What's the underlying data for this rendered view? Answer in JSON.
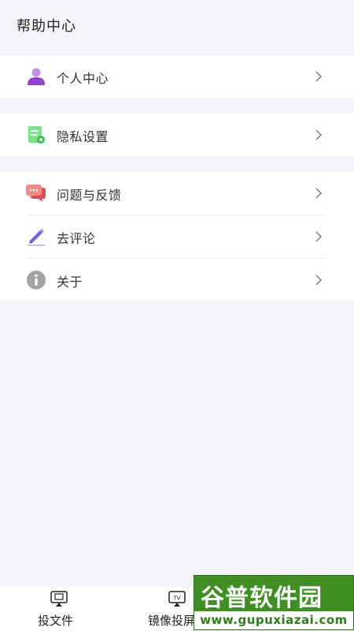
{
  "header": {
    "title": "帮助中心"
  },
  "group1": [
    {
      "label": "个人中心",
      "icon": "person-icon"
    }
  ],
  "group2": [
    {
      "label": "隐私设置",
      "icon": "privacy-settings-icon"
    }
  ],
  "group3": [
    {
      "label": "问题与反馈",
      "icon": "feedback-chat-icon"
    },
    {
      "label": "去评论",
      "icon": "pen-icon"
    },
    {
      "label": "关于",
      "icon": "info-icon"
    }
  ],
  "tabbar": {
    "tabs": [
      {
        "label": "投文件",
        "icon": "file-cast-icon"
      },
      {
        "label": "镜像投屏",
        "icon": "tv-cast-icon"
      }
    ]
  },
  "watermark": {
    "line1": "谷普软件园",
    "line2": "www.gupuxiazai.com"
  },
  "colors": {
    "background": "#f4f5f8",
    "card": "#ffffff",
    "person_icon": "#9b59d6",
    "privacy_icon": "#6ddc7a",
    "feedback_icon": "#ef6b6b",
    "pen_icon": "#7b5ce6",
    "info_icon": "#9a9a9a",
    "watermark_green": "#3f8f22"
  }
}
